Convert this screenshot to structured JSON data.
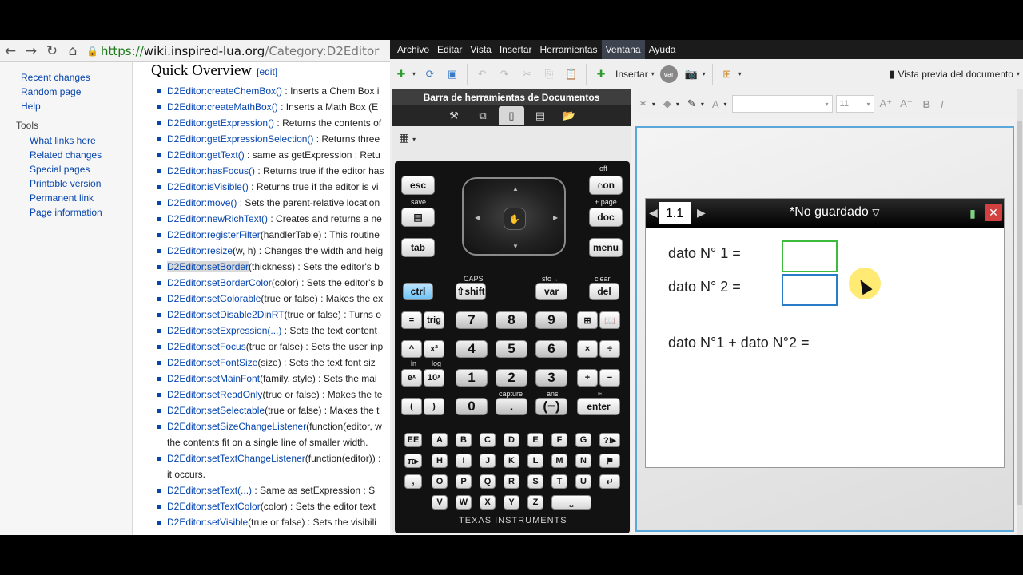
{
  "browser": {
    "url_scheme": "https://",
    "url_host": "wiki.inspired-lua.org",
    "url_path": "/Category:D2Editor",
    "sidebar_top": [
      "Recent changes",
      "Random page",
      "Help"
    ],
    "tools_heading": "Tools",
    "sidebar_tools": [
      "What links here",
      "Related changes",
      "Special pages",
      "Printable version",
      "Permanent link",
      "Page information"
    ],
    "section_title": "Quick Overview",
    "edit_label": "[edit]",
    "methods": [
      {
        "fn": "D2Editor:createChemBox()",
        "desc": " : Inserts a Chem Box i"
      },
      {
        "fn": "D2Editor:createMathBox()",
        "desc": " : Inserts a Math Box (E"
      },
      {
        "fn": "D2Editor:getExpression()",
        "desc": " : Returns the contents of"
      },
      {
        "fn": "D2Editor:getExpressionSelection()",
        "desc": " : Returns three"
      },
      {
        "fn": "D2Editor:getText()",
        "desc": " : same as getExpression : Retu"
      },
      {
        "fn": "D2Editor:hasFocus()",
        "desc": " : Returns true if the editor has"
      },
      {
        "fn": "D2Editor:isVisible()",
        "desc": " : Returns true if the editor is vi"
      },
      {
        "fn": "D2Editor:move()",
        "desc": " : Sets the parent-relative location"
      },
      {
        "fn": "D2Editor:newRichText()",
        "desc": " : Creates and returns a ne"
      },
      {
        "fn": "D2Editor:registerFilter",
        "desc": "(handlerTable) : This routine"
      },
      {
        "fn": "D2Editor:resize",
        "desc": "(w, h) : Changes the width and heig"
      },
      {
        "fn": "D2Editor:setBorder",
        "desc": "(thickness) : Sets the editor's b"
      },
      {
        "fn": "D2Editor:setBorderColor",
        "desc": "(color) : Sets the editor's b"
      },
      {
        "fn": "D2Editor:setColorable",
        "desc": "(true or false) : Makes the ex"
      },
      {
        "fn": "D2Editor:setDisable2DinRT",
        "desc": "(true or false) : Turns o"
      },
      {
        "fn": "D2Editor:setExpression(...)",
        "desc": " : Sets the text content"
      },
      {
        "fn": "D2Editor:setFocus",
        "desc": "(true or false) : Sets the user inp"
      },
      {
        "fn": "D2Editor:setFontSize",
        "desc": "(size) : Sets the text font siz"
      },
      {
        "fn": "D2Editor:setMainFont",
        "desc": "(family, style) : Sets the mai"
      },
      {
        "fn": "D2Editor:setReadOnly",
        "desc": "(true or false) : Makes the te"
      },
      {
        "fn": "D2Editor:setSelectable",
        "desc": "(true or false) : Makes the t"
      },
      {
        "fn": "D2Editor:setSizeChangeListener",
        "desc": "(function(editor, w"
      }
    ],
    "method_cont1": "the contents fit on a single line of smaller width.",
    "methods2": [
      {
        "fn": "D2Editor:setTextChangeListener",
        "desc": "(function(editor)) :"
      }
    ],
    "method_cont2": "it occurs.",
    "methods3": [
      {
        "fn": "D2Editor:setText(...)",
        "desc": " : Same as setExpression : S"
      },
      {
        "fn": "D2Editor:setTextColor",
        "desc": "(color) : Sets the editor text"
      },
      {
        "fn": "D2Editor:setVisible",
        "desc": "(true or false) : Sets the visibili"
      }
    ]
  },
  "app": {
    "menu": [
      "Archivo",
      "Editar",
      "Vista",
      "Insertar",
      "Herramientas",
      "Ventana",
      "Ayuda"
    ],
    "active_menu": "Ventana",
    "insert_label": "Insertar",
    "preview_label": "Vista previa del documento",
    "doc_toolbar_title": "Barra de herramientas de Documentos",
    "font_size": "11",
    "handheld": {
      "keys": {
        "esc": "esc",
        "on": "⌂on",
        "doc": "doc",
        "tab": "tab",
        "menu": "menu",
        "ctrl": "ctrl",
        "shift": "⇧shift",
        "var": "var",
        "del": "del",
        "eq": "=",
        "trig": "trig",
        "k7": "7",
        "k8": "8",
        "k9": "9",
        "caret": "^",
        "x2": "x²",
        "k4": "4",
        "k5": "5",
        "k6": "6",
        "times": "×",
        "div": "÷",
        "ex": "eˣ",
        "tenx": "10ˣ",
        "k1": "1",
        "k2": "2",
        "k3": "3",
        "plus": "+",
        "minus": "−",
        "lpar": "(",
        "rpar": ")",
        "k0": "0",
        "dot": ".",
        "neg": "(−)",
        "enter": "enter",
        "ee": "EE",
        "pi": "π▸",
        "comma": ",",
        "flag": "?!▸",
        "ret": "↵"
      },
      "labels": {
        "off": "off",
        "save": "save",
        "page": "+ page",
        "caps": "CAPS",
        "sto": "sto→",
        "clear": "clear",
        "capture": "capture",
        "ans": "ans",
        "ln": "ln",
        "log": "log",
        "approx": "≈"
      },
      "letters": [
        "A",
        "B",
        "C",
        "D",
        "E",
        "F",
        "G",
        "H",
        "I",
        "J",
        "K",
        "L",
        "M",
        "N",
        "O",
        "P",
        "Q",
        "R",
        "S",
        "T",
        "U",
        "V",
        "W",
        "X",
        "Y",
        "Z"
      ],
      "brand": "TEXAS INSTRUMENTS"
    },
    "document": {
      "tab": "1.1",
      "title": "*No guardado",
      "line1": "dato N° 1 =",
      "line2": "dato N° 2 =",
      "line3": "dato N°1 + dato N°2 ="
    }
  }
}
